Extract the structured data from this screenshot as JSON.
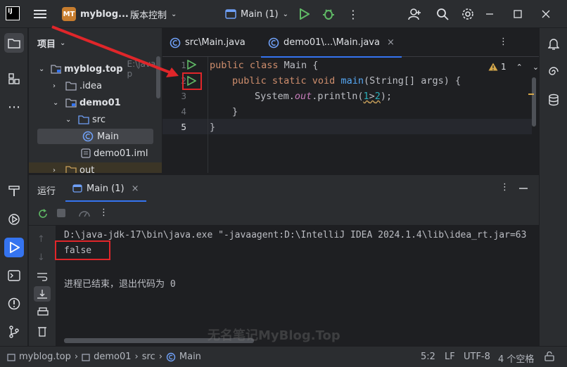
{
  "titlebar": {
    "logo_text": "IJ",
    "project_badge": "MT",
    "project_name": "myblog...",
    "vcs_label": "版本控制",
    "run_config": "Main (1)"
  },
  "project_panel": {
    "title": "项目",
    "tree": [
      {
        "label": "myblog.top",
        "hint": "E:\\java-p",
        "kind": "module"
      },
      {
        "label": ".idea",
        "kind": "folder"
      },
      {
        "label": "demo01",
        "kind": "module"
      },
      {
        "label": "src",
        "kind": "folder"
      },
      {
        "label": "Main",
        "kind": "class"
      },
      {
        "label": "demo01.iml",
        "kind": "file"
      },
      {
        "label": "out",
        "kind": "folder"
      }
    ]
  },
  "editor": {
    "tabs": [
      {
        "label": "src\\Main.java",
        "active": false
      },
      {
        "label": "demo01\\...\\Main.java",
        "active": true
      }
    ],
    "warnings_count": "1",
    "line_numbers": [
      "1",
      "2",
      "3",
      "4",
      "5"
    ],
    "code": {
      "l1_kw": "public class ",
      "l1_name": "Main {",
      "l2_kw": "public static void ",
      "l2_fn": "main",
      "l2_rest": "(String[] args) {",
      "l3_a": "System.",
      "l3_out": "out",
      "l3_b": ".println(",
      "l3_n1": "1",
      "l3_op": ">",
      "l3_n2": "2",
      "l3_c": ");",
      "l4": "}",
      "l5": "}"
    }
  },
  "run_panel": {
    "title": "运行",
    "tab_label": "Main (1)",
    "console_lines": [
      "D:\\java-jdk-17\\bin\\java.exe \"-javaagent:D:\\IntelliJ IDEA 2024.1.4\\lib\\idea_rt.jar=63",
      "false",
      "",
      "进程已结束，退出代码为 0"
    ]
  },
  "watermark": "无名笔记MyBlog.Top",
  "statusbar": {
    "breadcrumb": [
      "myblog.top",
      "demo01",
      "src",
      "Main"
    ],
    "position": "5:2",
    "line_sep": "LF",
    "encoding": "UTF-8",
    "indent": "4 个空格"
  },
  "colors": {
    "accent": "#3574f0",
    "run_green": "#5fb865",
    "annotation_red": "#e0262a"
  }
}
